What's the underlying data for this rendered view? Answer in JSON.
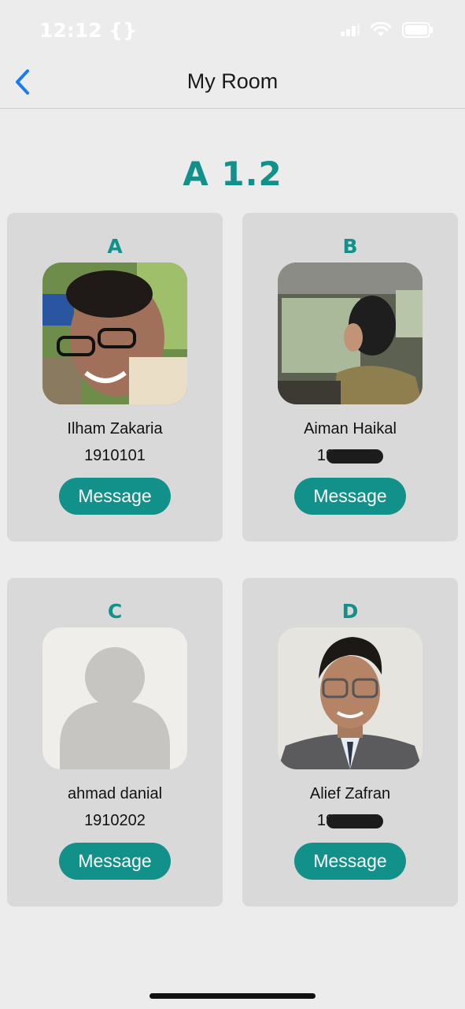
{
  "status": {
    "time": "12:12 {}",
    "icons": [
      "signal-icon",
      "wifi-icon",
      "battery-icon"
    ]
  },
  "nav": {
    "back_icon": "chevron-left-icon",
    "title": "My Room"
  },
  "room": {
    "title": "A 1.2"
  },
  "cards": [
    {
      "letter": "A",
      "name": "Ilham Zakaria",
      "id": "1910101",
      "id_redacted": false,
      "photo": "photo-ilham",
      "button": "Message"
    },
    {
      "letter": "B",
      "name": "Aiman Haikal",
      "id": "19",
      "id_redacted": true,
      "photo": "photo-aiman",
      "button": "Message"
    },
    {
      "letter": "C",
      "name": "ahmad danial",
      "id": "1910202",
      "id_redacted": false,
      "photo": "avatar-placeholder",
      "button": "Message"
    },
    {
      "letter": "D",
      "name": "Alief Zafran",
      "id": "19",
      "id_redacted": true,
      "photo": "photo-alief",
      "button": "Message"
    }
  ],
  "colors": {
    "accent": "#12908a",
    "card_bg": "#d9d9d9",
    "page_bg": "#ececec",
    "back_blue": "#1a7cf0"
  }
}
